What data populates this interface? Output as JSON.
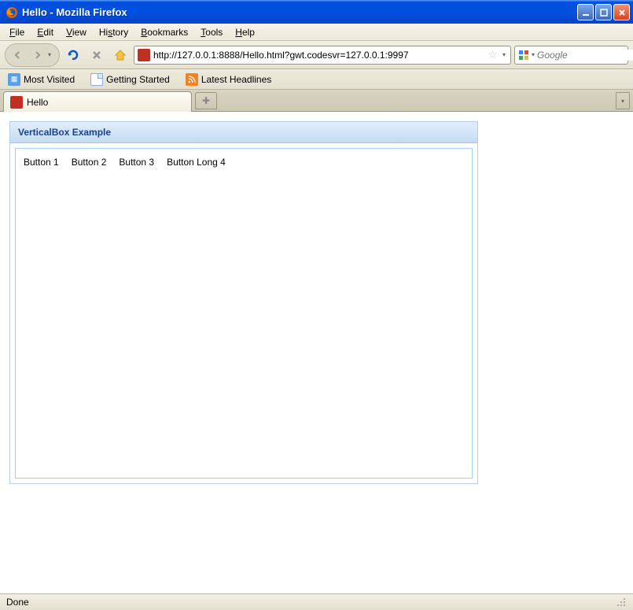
{
  "window": {
    "title": "Hello - Mozilla Firefox"
  },
  "menubar": {
    "items": [
      {
        "label": "File",
        "accel": "F"
      },
      {
        "label": "Edit",
        "accel": "E"
      },
      {
        "label": "View",
        "accel": "V"
      },
      {
        "label": "History",
        "accel": "s"
      },
      {
        "label": "Bookmarks",
        "accel": "B"
      },
      {
        "label": "Tools",
        "accel": "T"
      },
      {
        "label": "Help",
        "accel": "H"
      }
    ]
  },
  "toolbar": {
    "url": "http://127.0.0.1:8888/Hello.html?gwt.codesvr=127.0.0.1:9997",
    "search_placeholder": "Google"
  },
  "bookmarks": {
    "items": [
      {
        "label": "Most Visited",
        "icon": "blue"
      },
      {
        "label": "Getting Started",
        "icon": "page"
      },
      {
        "label": "Latest Headlines",
        "icon": "rss"
      }
    ]
  },
  "tabs": {
    "active": {
      "label": "Hello"
    }
  },
  "panel": {
    "title": "VerticalBox Example",
    "buttons": [
      "Button 1",
      "Button 2",
      "Button 3",
      "Button Long 4"
    ]
  },
  "statusbar": {
    "text": "Done"
  }
}
